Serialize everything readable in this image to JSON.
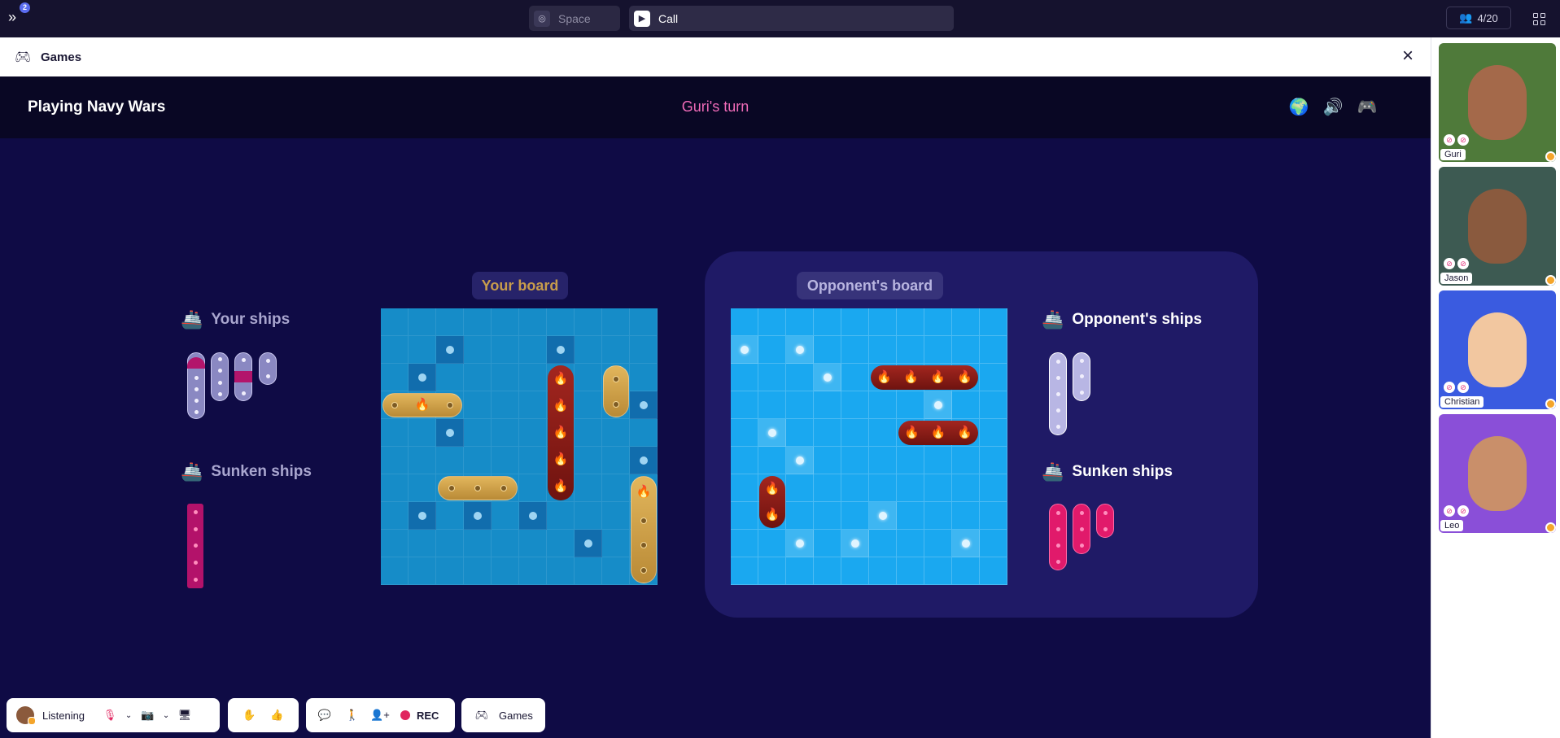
{
  "topbar": {
    "notification_count": "2",
    "space_tab": "Space",
    "call_tab": "Call",
    "participants": "4/20"
  },
  "games_header": {
    "title": "Games"
  },
  "game": {
    "title": "Playing Navy Wars",
    "turn": "Guri's turn",
    "your_board_label": "Your board",
    "opponent_board_label": "Opponent's board",
    "your_ships_title": "Your ships",
    "sunken_ships_title": "Sunken ships",
    "opponent_ships_title": "Opponent's ships",
    "opponent_sunken_title": "Sunken ships"
  },
  "participants": [
    {
      "name": "Guri",
      "bg": "#4f7a3a",
      "skin": "#a4694a"
    },
    {
      "name": "Jason",
      "bg": "#3d5a52",
      "skin": "#8a5a3e"
    },
    {
      "name": "Christian",
      "bg": "#3a5be0",
      "skin": "#f2c7a0"
    },
    {
      "name": "Leo",
      "bg": "#8a4fd8",
      "skin": "#c98f6a"
    }
  ],
  "toolbar": {
    "status": "Listening",
    "rec": "REC",
    "games": "Games"
  },
  "colors": {
    "background": "#0f0b45",
    "turn": "#f06bb8",
    "your_board": "#168cc8",
    "opponent_board": "#1aa8f0"
  },
  "icons": [
    "expand-icon",
    "planet-icon",
    "video-icon",
    "users-icon",
    "grid-icon",
    "gamepad-icon",
    "close-icon",
    "globe-icon",
    "speaker-icon",
    "ship-icon",
    "fire-icon",
    "mic-off-icon",
    "camera-off-icon",
    "screen-icon",
    "hand-icon",
    "thumbs-up-icon",
    "chat-icon",
    "walk-icon",
    "add-user-icon"
  ]
}
